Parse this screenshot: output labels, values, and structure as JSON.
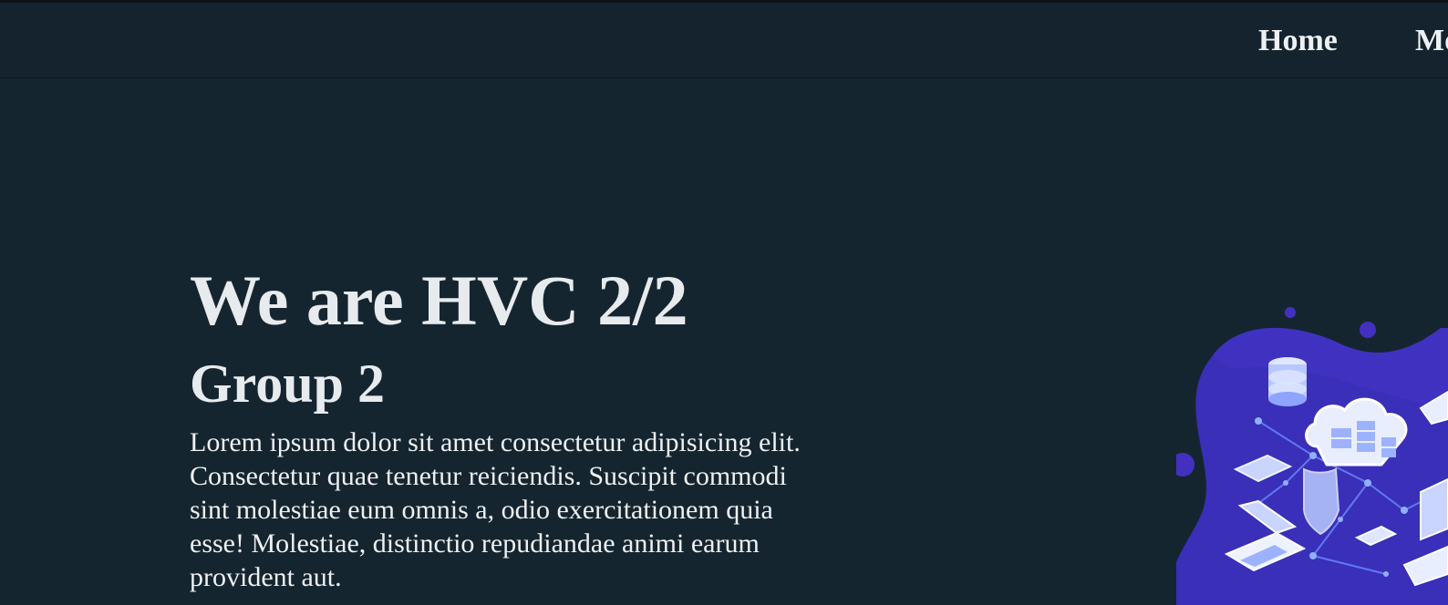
{
  "nav": {
    "items": [
      {
        "label": "Home"
      },
      {
        "label": "Mo"
      }
    ]
  },
  "hero": {
    "title": "We are HVC 2/2",
    "subtitle": "Group 2",
    "text": "Lorem ipsum dolor sit amet consectetur adipisicing elit. Consectetur quae tenetur reiciendis. Suscipit commodi sint molestiae eum omnis a, odio exercitationem quia esse! Molestiae, distinctio repudiandae animi earum provident aut."
  },
  "colors": {
    "background": "#152530",
    "navbar": "#14232e",
    "text": "#e7ebed",
    "illustration_blob": "#3a2fb8",
    "illustration_light": "#c9d4ff"
  },
  "illustration": {
    "icon": "cloud-network-icon"
  }
}
